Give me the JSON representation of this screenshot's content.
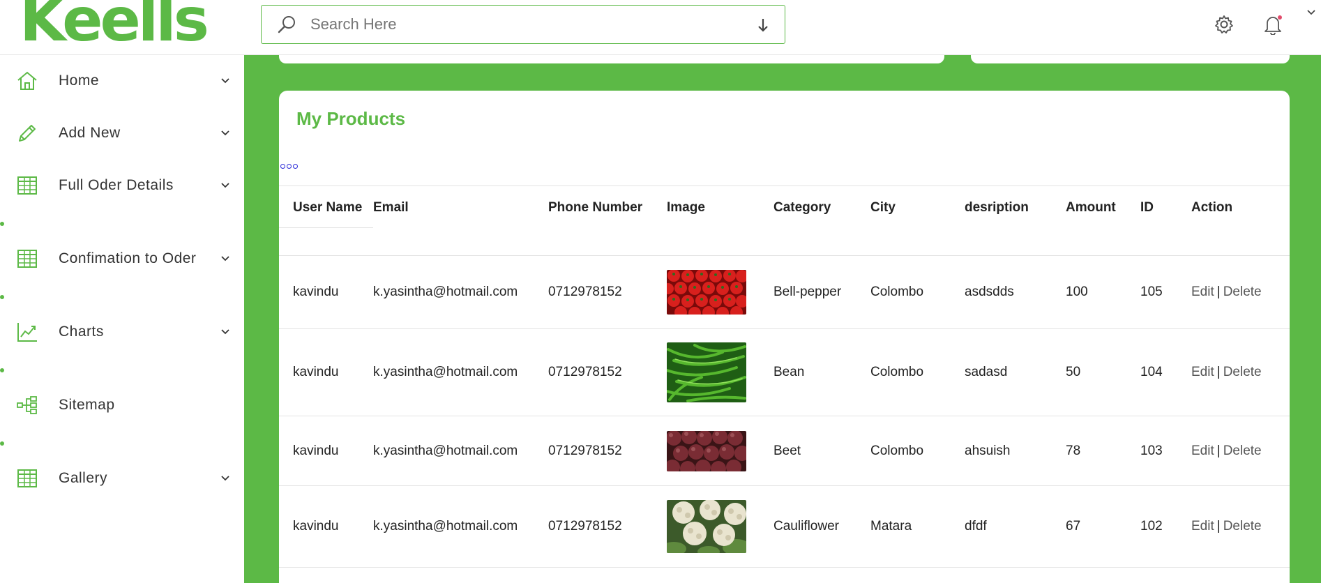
{
  "header": {
    "logo_text": "Keells",
    "search": {
      "placeholder": "Search Here",
      "value": ""
    },
    "icons": [
      "search-icon",
      "arrow-down-icon",
      "gear-icon",
      "bell-icon",
      "chevron-down-icon"
    ],
    "brand_color": "#5cb946",
    "notification_dot_color": "#e24b6b"
  },
  "sidebar": {
    "items": [
      {
        "label": "Home",
        "icon": "home-icon"
      },
      {
        "label": "Add New",
        "icon": "pencil-icon"
      },
      {
        "label": "Full Oder Details",
        "icon": "table-icon"
      },
      {
        "label": "Confimation to Oder",
        "icon": "table-icon"
      },
      {
        "label": "Charts",
        "icon": "line-chart-icon"
      },
      {
        "label": "Sitemap",
        "icon": "sitemap-icon"
      },
      {
        "label": "Gallery",
        "icon": "table-icon"
      }
    ]
  },
  "products": {
    "title": "My Products",
    "columns": [
      "User Name",
      "Email",
      "Phone Number",
      "Image",
      "Category",
      "City",
      "desription",
      "Amount",
      "ID",
      "Action"
    ],
    "rows": [
      {
        "user": "kavindu",
        "email": "k.yasintha@hotmail.com",
        "phone": "0712978152",
        "image": "bell-pepper-image",
        "category": "Bell-pepper",
        "city": "Colombo",
        "description": "asdsdds",
        "amount": "100",
        "id": "105"
      },
      {
        "user": "kavindu",
        "email": "k.yasintha@hotmail.com",
        "phone": "0712978152",
        "image": "bean-image",
        "category": "Bean",
        "city": "Colombo",
        "description": "sadasd",
        "amount": "50",
        "id": "104"
      },
      {
        "user": "kavindu",
        "email": "k.yasintha@hotmail.com",
        "phone": "0712978152",
        "image": "beet-image",
        "category": "Beet",
        "city": "Colombo",
        "description": "ahsuish",
        "amount": "78",
        "id": "103"
      },
      {
        "user": "kavindu",
        "email": "k.yasintha@hotmail.com",
        "phone": "0712978152",
        "image": "cauliflower-image",
        "category": "Cauliflower",
        "city": "Matara",
        "description": "dfdf",
        "amount": "67",
        "id": "102"
      }
    ],
    "action_edit": "Edit",
    "action_separator": "|",
    "action_delete": "Delete"
  }
}
